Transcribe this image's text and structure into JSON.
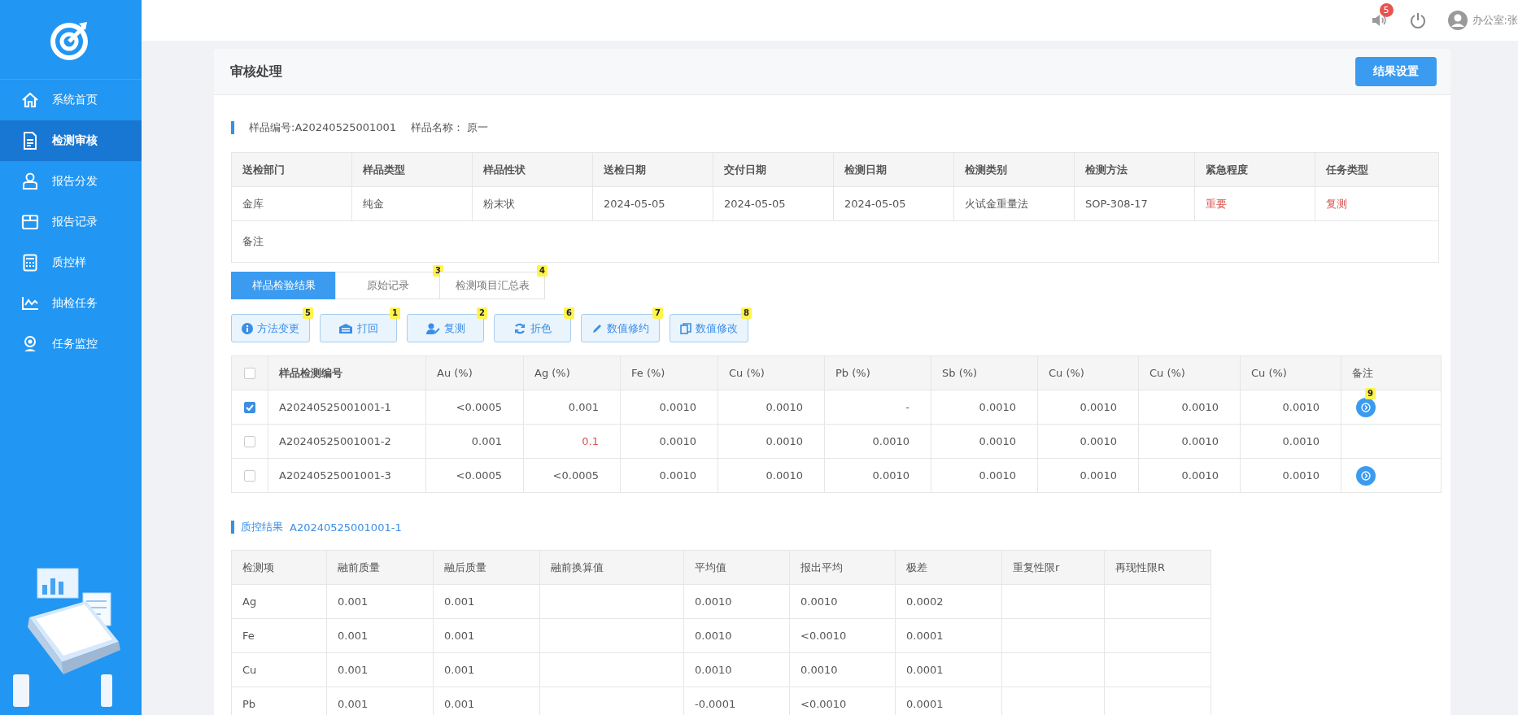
{
  "sidebar": {
    "items": [
      {
        "label": "系统首页",
        "selected": false
      },
      {
        "label": "检测审核",
        "selected": true
      },
      {
        "label": "报告分发",
        "selected": false
      },
      {
        "label": "报告记录",
        "selected": false
      },
      {
        "label": "质控样",
        "selected": false
      },
      {
        "label": "抽检任务",
        "selected": false
      },
      {
        "label": "任务监控",
        "selected": false
      }
    ]
  },
  "header": {
    "notification_count": "5",
    "user": "办公室:张"
  },
  "card": {
    "title": "审核处理",
    "action_button": "结果设置"
  },
  "sample_info": {
    "sample_no": "样品编号:A20240525001001",
    "sample_name": "样品名称： 原一"
  },
  "info_table": {
    "columns": [
      "送检部门",
      "样品类型",
      "样品性状",
      "送检日期",
      "交付日期",
      "检测日期",
      "检测类别",
      "检测方法",
      "紧急程度",
      "任务类型"
    ],
    "cells": [
      {
        "text": "金库",
        "flagged": false
      },
      {
        "text": "纯金",
        "flagged": false
      },
      {
        "text": "粉末状",
        "flagged": false
      },
      {
        "text": "2024-05-05",
        "flagged": false
      },
      {
        "text": "2024-05-05",
        "flagged": false
      },
      {
        "text": "2024-05-05",
        "flagged": false
      },
      {
        "text": "火试金重量法",
        "flagged": false
      },
      {
        "text": "SOP-308-17",
        "flagged": false
      },
      {
        "text": "重要",
        "flagged": true
      },
      {
        "text": "复测",
        "flagged": true
      }
    ],
    "remark_label": "备注"
  },
  "tabs": [
    {
      "label": "样品检验结果",
      "selected": true
    },
    {
      "label": "原始记录",
      "selected": false,
      "marker": "3"
    },
    {
      "label": "检测项目汇总表",
      "selected": false,
      "marker": "4"
    }
  ],
  "toolbar": [
    {
      "label": "方法变更",
      "marker": "5"
    },
    {
      "label": "打回",
      "marker": "1"
    },
    {
      "label": "复测",
      "marker": "2"
    },
    {
      "label": "折色",
      "marker": "6"
    },
    {
      "label": "数值修约",
      "marker": "7"
    },
    {
      "label": "数值修改",
      "marker": "8"
    }
  ],
  "results_table": {
    "all_checked": false,
    "columns": [
      "样品检测编号",
      "Au (%)",
      "Ag (%)",
      "Fe (%)",
      "Cu (%)",
      "Pb (%)",
      "Sb (%)",
      "Cu (%)",
      "Cu (%)",
      "Cu (%)",
      "备注"
    ],
    "rows": [
      {
        "checked": true,
        "note": true,
        "note_marker": "9",
        "cells": [
          {
            "text": "A20240525001001-1",
            "flagged": false
          },
          {
            "text": "<0.0005",
            "flagged": false
          },
          {
            "text": "0.001",
            "flagged": false
          },
          {
            "text": "0.0010",
            "flagged": false
          },
          {
            "text": "0.0010",
            "flagged": false
          },
          {
            "text": "-",
            "flagged": false
          },
          {
            "text": "0.0010",
            "flagged": false
          },
          {
            "text": "0.0010",
            "flagged": false
          },
          {
            "text": "0.0010",
            "flagged": false
          },
          {
            "text": "0.0010",
            "flagged": false
          }
        ]
      },
      {
        "checked": false,
        "note": false,
        "cells": [
          {
            "text": "A20240525001001-2",
            "flagged": false
          },
          {
            "text": "0.001",
            "flagged": false
          },
          {
            "text": "0.1",
            "flagged": true
          },
          {
            "text": "0.0010",
            "flagged": false
          },
          {
            "text": "0.0010",
            "flagged": false
          },
          {
            "text": "0.0010",
            "flagged": false
          },
          {
            "text": "0.0010",
            "flagged": false
          },
          {
            "text": "0.0010",
            "flagged": false
          },
          {
            "text": "0.0010",
            "flagged": false
          },
          {
            "text": "0.0010",
            "flagged": false
          }
        ]
      },
      {
        "checked": false,
        "note": true,
        "cells": [
          {
            "text": "A20240525001001-3",
            "flagged": false
          },
          {
            "text": "<0.0005",
            "flagged": false
          },
          {
            "text": "<0.0005",
            "flagged": false
          },
          {
            "text": "0.0010",
            "flagged": false
          },
          {
            "text": "0.0010",
            "flagged": false
          },
          {
            "text": "0.0010",
            "flagged": false
          },
          {
            "text": "0.0010",
            "flagged": false
          },
          {
            "text": "0.0010",
            "flagged": false
          },
          {
            "text": "0.0010",
            "flagged": false
          },
          {
            "text": "0.0010",
            "flagged": false
          }
        ]
      }
    ]
  },
  "qc": {
    "title": "质控结果",
    "sample": "A20240525001001-1",
    "columns": [
      "检测项",
      "融前质量",
      "融后质量",
      "融前换算值",
      "平均值",
      "报出平均",
      "极差",
      "重复性限r",
      "再现性限R"
    ],
    "rows": [
      [
        "Ag",
        "0.001",
        "0.001",
        null,
        "0.0010",
        "0.0010",
        "0.0002",
        null,
        null
      ],
      [
        "Fe",
        "0.001",
        "0.001",
        null,
        "0.0010",
        "<0.0010",
        "0.0001",
        null,
        null
      ],
      [
        "Cu",
        "0.001",
        "0.001",
        null,
        "0.0010",
        "0.0010",
        "0.0001",
        null,
        null
      ],
      [
        "Pb",
        "0.001",
        "0.001",
        null,
        "-0.0001",
        "<0.0010",
        "0.0001",
        null,
        null
      ]
    ]
  }
}
